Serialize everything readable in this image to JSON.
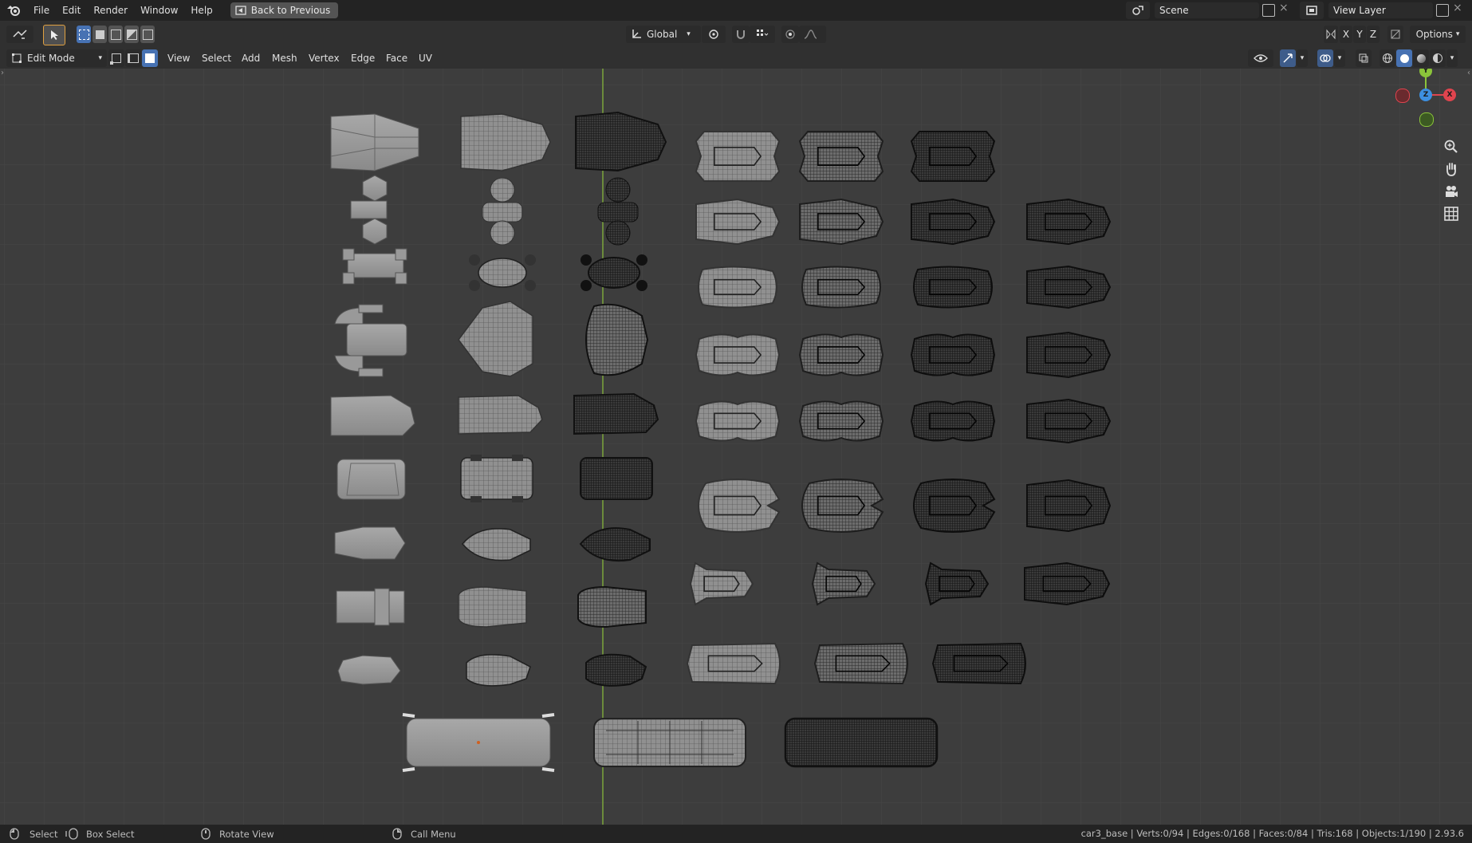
{
  "topbar": {
    "menus": [
      "File",
      "Edit",
      "Render",
      "Window",
      "Help"
    ],
    "back_button": "Back to Previous",
    "scene": "Scene",
    "view_layer": "View Layer"
  },
  "header": {
    "transform_orientation": "Global",
    "options_label": "Options",
    "axis_x": "X",
    "axis_y": "Y",
    "axis_z": "Z",
    "mode": "Edit Mode",
    "menus": [
      "View",
      "Select",
      "Add",
      "Mesh",
      "Vertex",
      "Edge",
      "Face",
      "UV"
    ]
  },
  "gizmo": {
    "y_label": "Y",
    "z_label": "Z",
    "x_label": "X",
    "colors": {
      "x": "#e0444e",
      "y": "#8bc43a",
      "z": "#3d8fe0"
    }
  },
  "viewport": {
    "background": "#3d3d3d",
    "grid_color": "#464646",
    "axis_line_color": "#7aa33a"
  },
  "statusbar": {
    "select": "Select",
    "box_select": "Box Select",
    "rotate_view": "Rotate View",
    "call_menu": "Call Menu",
    "stats": "car3_base | Verts:0/94 | Edges:0/168 | Faces:0/84 | Tris:168 | Objects:1/190 | 2.93.6"
  }
}
